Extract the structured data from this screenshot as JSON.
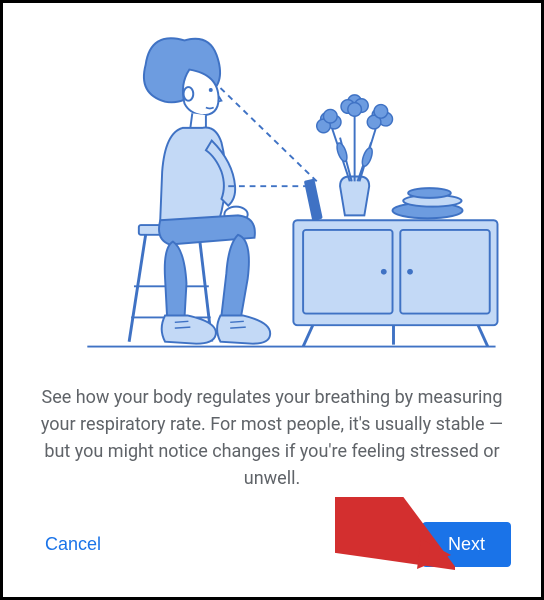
{
  "description": "See how your body regulates your breathing by measuring your respiratory rate. For most people, it's usually stable — but you might notice changes if you're feeling stressed or unwell.",
  "buttons": {
    "cancel": "Cancel",
    "next": "Next"
  },
  "colors": {
    "primary": "#1a73e8",
    "illustration_fill": "#c3d9f6",
    "illustration_stroke": "#3f72c4",
    "text_secondary": "#5f6368",
    "arrow": "#d32f2f"
  },
  "illustration": {
    "alt": "Person sitting on stool looking at phone on cabinet with flowers and books, dashed lines from face to phone"
  }
}
